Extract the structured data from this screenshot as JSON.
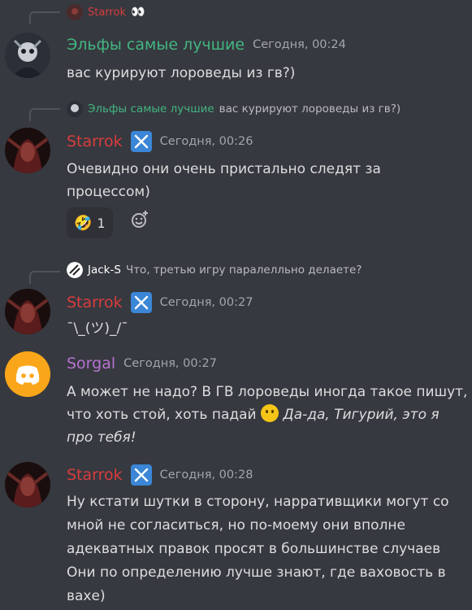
{
  "colors": {
    "background": "#36393f",
    "starrok_name": "#d83c3e",
    "elfy_name": "#43b581",
    "sorgal_name": "#b673d1",
    "discord_avatar": "#faa61a",
    "badge": "#3b86d6"
  },
  "messages": [
    {
      "reply": {
        "author": "Starrok",
        "text": "",
        "icon": "eyes-emoji-icon",
        "eyes": "👀"
      },
      "author": "Эльфы самые лучшие",
      "timestamp": "Сегодня, 00:24",
      "lines": [
        "вас курируют лороведы из гв?)"
      ]
    },
    {
      "reply": {
        "author": "Эльфы самые лучшие",
        "text": "вас курируют лороведы из гв?)"
      },
      "author": "Starrok",
      "badge_icon": "crossed-swords-icon",
      "timestamp": "Сегодня, 00:26",
      "lines": [
        "Очевидно они очень пристально следят за",
        "процессом)"
      ],
      "reaction": {
        "emoji": "🤣",
        "count": "1"
      },
      "add_reaction_icon": "add-reaction-icon"
    },
    {
      "reply": {
        "author": "Jack-S",
        "text": "Что, третью игру паралелльно делаете?"
      },
      "author": "Starrok",
      "badge_icon": "crossed-swords-icon",
      "timestamp": "Сегодня, 00:27",
      "lines": [
        "¯\\_(ツ)_/¯"
      ]
    },
    {
      "author": "Sorgal",
      "timestamp": "Сегодня, 00:27",
      "avatar_icon": "discord-logo-icon",
      "lines": [
        "А может не надо? В ГВ лороведы иногда такое пишут,",
        "что хоть стой, хоть падай"
      ],
      "italic_a": "Да-да, Тигурий, это я",
      "italic_b": "про тебя!"
    },
    {
      "author": "Starrok",
      "badge_icon": "crossed-swords-icon",
      "timestamp": "Сегодня, 00:28",
      "lines": [
        "Ну кстати шутки в сторону, нарративщики могут со",
        "мной не согласиться, но по-моему они вполне",
        "адекватных правок просят в большинстве случаев",
        "Они по определению лучше знают, где ваховость в",
        "вахе)"
      ]
    }
  ]
}
